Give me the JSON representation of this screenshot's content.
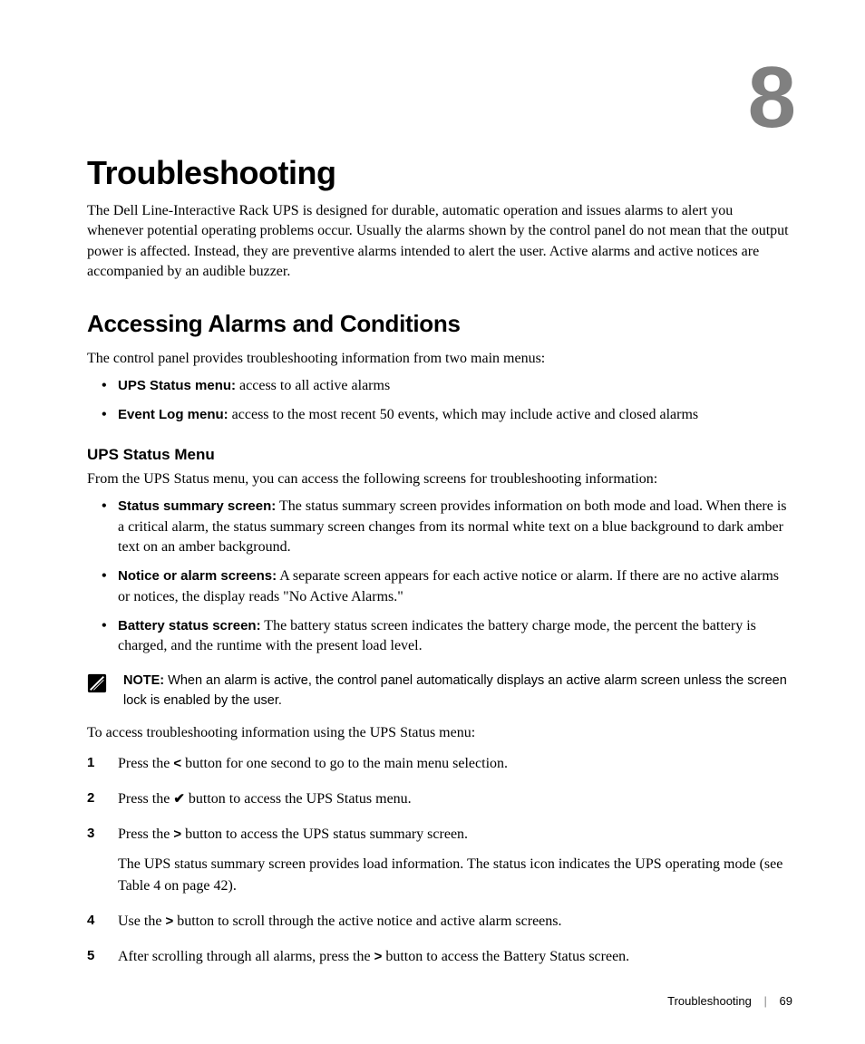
{
  "chapter": {
    "number": "8",
    "title": "Troubleshooting",
    "intro": "The Dell Line-Interactive Rack UPS is designed for durable, automatic operation and issues alarms to alert you whenever potential operating problems occur. Usually the alarms shown by the control panel do not mean that the output power is affected. Instead, they are preventive alarms intended to alert the user. Active alarms and active notices are accompanied by an audible buzzer."
  },
  "section1": {
    "title": "Accessing Alarms and Conditions",
    "intro": "The control panel provides troubleshooting information from two main menus:",
    "bullets": [
      {
        "label": "UPS Status menu:",
        "text": " access to all active alarms"
      },
      {
        "label": "Event Log menu:",
        "text": " access to the most recent 50 events, which may include active and closed alarms"
      }
    ]
  },
  "subsection1": {
    "title": "UPS Status Menu",
    "intro": "From the UPS Status menu, you can access the following screens for troubleshooting information:",
    "bullets": [
      {
        "label": "Status summary screen:",
        "text": " The status summary screen provides information on both mode and load. When there is a critical alarm, the status summary screen changes from its normal white text on a blue background to dark amber text on an amber background."
      },
      {
        "label": "Notice or alarm screens:",
        "text": " A separate screen appears for each active notice or alarm. If there are no active alarms or notices, the display reads \"No Active Alarms.\""
      },
      {
        "label": "Battery status screen:",
        "text": " The battery status screen indicates the battery charge mode, the percent the battery is charged, and the runtime with the present load level."
      }
    ]
  },
  "note": {
    "label": "NOTE:",
    "text": " When an alarm is active, the control panel automatically displays an active alarm screen unless the screen lock is enabled by the user."
  },
  "steps_intro": "To access troubleshooting information using the UPS Status menu:",
  "steps": {
    "s1a": "Press the ",
    "s1b": " button for one second to go to the main menu selection.",
    "s2a": "Press the ",
    "s2b": " button to access the UPS Status menu.",
    "s3a": "Press the ",
    "s3b": " button to access the UPS status summary screen.",
    "s3sub": "The UPS status summary screen provides load information. The status icon indicates the UPS operating mode (see Table 4 on page 42).",
    "s4a": "Use the ",
    "s4b": " button to scroll through the active notice and active alarm screens.",
    "s5a": "After scrolling through all alarms, press the ",
    "s5b": " button to access the Battery Status screen."
  },
  "glyphs": {
    "left": "<",
    "check": "✔",
    "right": ">"
  },
  "footer": {
    "section": "Troubleshooting",
    "page": "69"
  }
}
